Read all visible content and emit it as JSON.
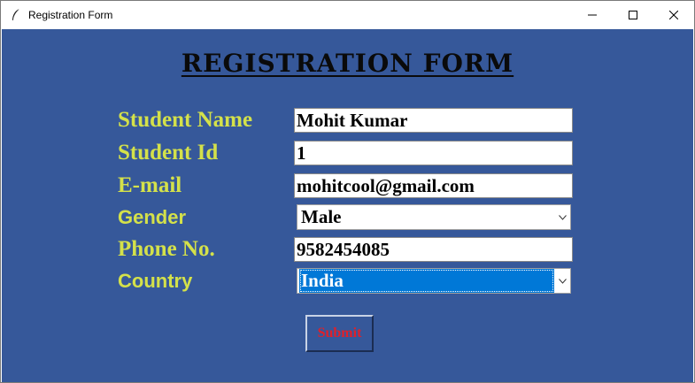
{
  "window": {
    "title": "Registration Form",
    "icon": "feather-icon",
    "controls": [
      "minimize-icon",
      "maximize-icon",
      "close-icon"
    ]
  },
  "form": {
    "heading": "REGISTRATION FORM",
    "labels": {
      "student_name": "Student Name",
      "student_id": "Student Id",
      "email": "E-mail",
      "gender": "Gender",
      "phone": "Phone No.",
      "country": "Country"
    },
    "values": {
      "student_name": "Mohit Kumar",
      "student_id": "1",
      "email": "mohitcool@gmail.com",
      "gender": "Male",
      "phone": "9582454085",
      "country": "India"
    },
    "submit_label": "Submit"
  },
  "colors": {
    "background": "#36589a",
    "label": "#d4e14a",
    "submit_text": "#e0202a",
    "selection": "#0078d7"
  }
}
